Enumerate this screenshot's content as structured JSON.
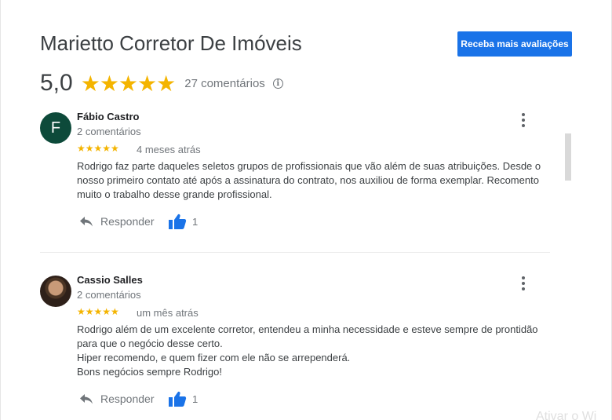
{
  "header": {
    "title": "Marietto Corretor De Imóveis",
    "cta_label": "Receba mais avaliações",
    "rating_value": "5,0",
    "stars": "★★★★★",
    "review_count": "27 comentários",
    "info_glyph": "i"
  },
  "colors": {
    "accent": "#1a73e8",
    "star": "#f4b400",
    "avatar_bg": "#0d4a3a"
  },
  "reviews": [
    {
      "avatar_letter": "F",
      "name": "Fábio Castro",
      "meta": "2 comentários",
      "stars": "★★★★★",
      "date": "4 meses atrás",
      "text": [
        "Rodrigo faz parte daqueles seletos grupos de profissionais que vão além de suas atribuições. Desde o",
        "nosso primeiro contato até após a assinatura do contrato, nos auxiliou de forma exemplar. Recomento",
        "muito o trabalho desse grande profissional."
      ],
      "reply_label": "Responder",
      "likes": "1"
    },
    {
      "avatar_letter": "",
      "name": "Cassio Salles",
      "meta": "2 comentários",
      "stars": "★★★★★",
      "date": "um mês atrás",
      "text": [
        "Rodrigo além de um excelente corretor, entendeu a minha necessidade e esteve sempre de prontidão",
        "para que o negócio desse certo.",
        "Hiper recomendo, e quem fizer com ele não se arrependerá.",
        "Bons negócios sempre Rodrigo!"
      ],
      "reply_label": "Responder",
      "likes": "1"
    }
  ],
  "icons": {
    "reply": "reply-arrow-icon",
    "like": "thumbs-up-icon",
    "more": "more-vert-icon",
    "info": "info-icon"
  },
  "watermark": "Ativar o Wi"
}
